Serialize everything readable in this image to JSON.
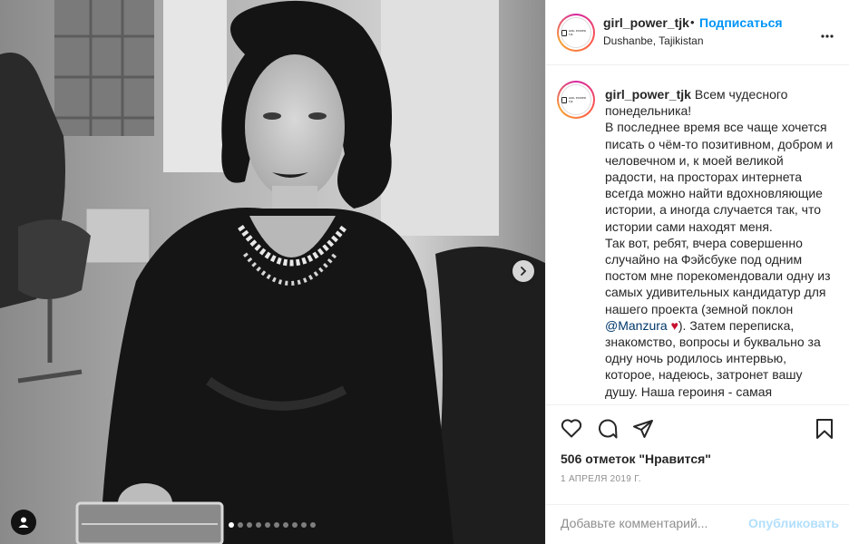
{
  "post": {
    "username": "girl_power_tjk",
    "separator": "•",
    "follow_label": "Подписаться",
    "location": "Dushanbe, Tajikistan",
    "avatar_logo_text": "GIRL POWER TJK",
    "caption": {
      "username": "girl_power_tjk",
      "lines": [
        "Всем чудесного понедельника!",
        "В последнее время все чаще хочется писать о чём-то позитивном, добром и человечном и, к моей великой радости, на просторах интернета всегда можно найти вдохновляющие истории, а иногда случается так, что истории сами находят меня.",
        "Так вот, ребят, вчера совершенно случайно на Фэйсбуке под одним постом мне порекомендовали одну из самых удивительных кандидатур для нашего проекта (земной поклон",
        "@Manzura",
        "♥",
        "). Затем переписка, знакомство, вопросы и буквально за одну ночь родилось интервью, которое, надеюсь, затронет вашу душу. Наша героиня - самая"
      ]
    },
    "likes": "506 отметок \"Нравится\"",
    "date": "1 АПРЕЛЯ 2019 Г.",
    "comment_placeholder": "Добавьте комментарий...",
    "publish_label": "Опубликовать",
    "carousel": {
      "total": 10,
      "active_index": 0
    }
  },
  "icons": {
    "more": "more-horizontal-icon",
    "like": "heart-icon",
    "comment": "comment-icon",
    "share": "paper-plane-icon",
    "save": "bookmark-icon",
    "next": "chevron-right-icon",
    "tag": "user-tag-icon"
  },
  "colors": {
    "link_blue": "#0095f6",
    "publish_disabled": "#b2dffc",
    "text": "#262626",
    "muted": "#8e8e8e",
    "heart_red": "#c8102e"
  }
}
